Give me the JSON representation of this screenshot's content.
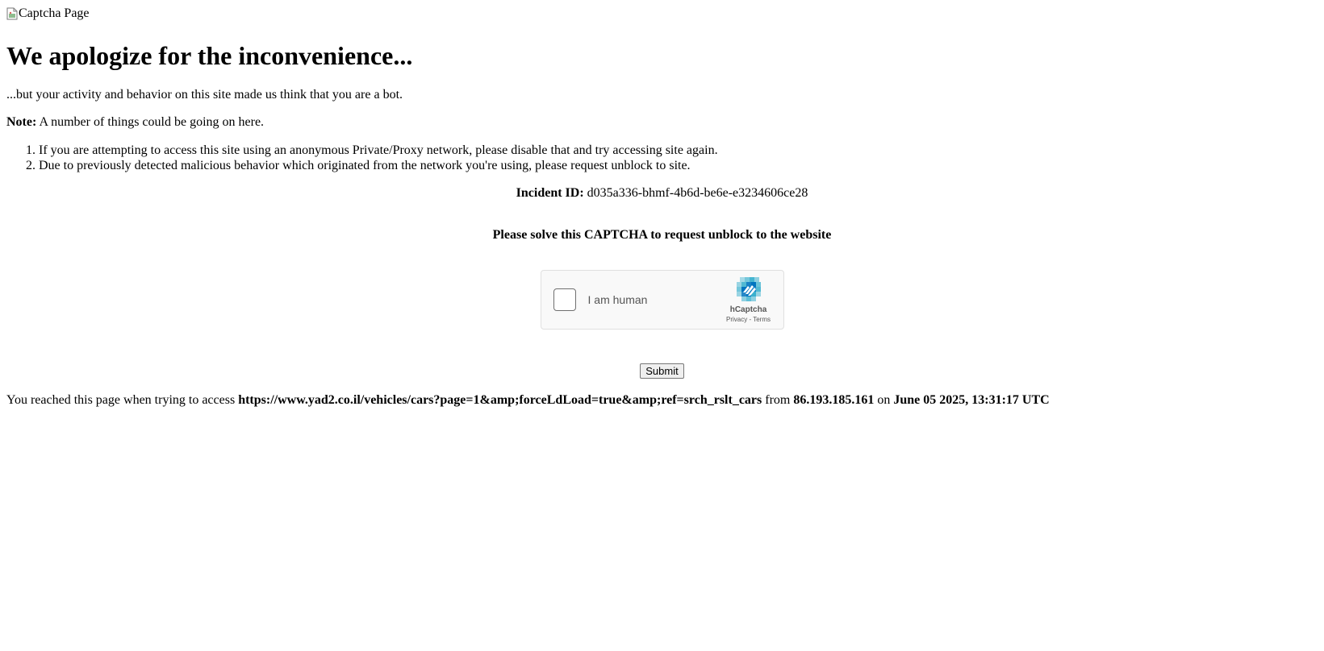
{
  "header_image": {
    "alt_text": "Captcha Page",
    "icon": "broken-image-icon"
  },
  "heading": "We apologize for the inconvenience...",
  "lead": "...but your activity and behavior on this site made us think that you are a bot.",
  "note": {
    "label": "Note:",
    "text": "A number of things could be going on here."
  },
  "reasons": [
    "If you are attempting to access this site using an anonymous Private/Proxy network, please disable that and try accessing site again.",
    "Due to previously detected malicious behavior which originated from the network you're using, please request unblock to site."
  ],
  "incident": {
    "label": "Incident ID:",
    "value": "d035a336-bhmf-4b6d-be6e-e3234606ce28"
  },
  "captcha": {
    "heading": "Please solve this CAPTCHA to request unblock to the website",
    "widget": {
      "checkbox_label": "I am human",
      "brand": "hCaptcha",
      "privacy": "Privacy",
      "separator": " - ",
      "terms": "Terms"
    }
  },
  "submit_label": "Submit",
  "footer": {
    "prefix": "You reached this page when trying to access",
    "url": "https://www.yad2.co.il/vehicles/cars?page=1&amp;forceLdLoad=true&amp;ref=srch_rslt_cars",
    "from_word": "from",
    "ip": "86.193.185.161",
    "on_word": "on",
    "timestamp": "June 05 2025, 13:31:17 UTC"
  }
}
